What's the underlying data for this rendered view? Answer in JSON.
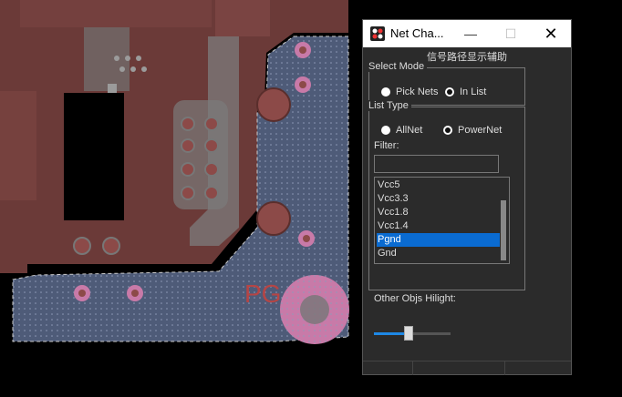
{
  "window": {
    "title": "Net Cha...",
    "subtitle": "信号路径显示辅助",
    "minimize_glyph": "—",
    "maximize_glyph": "☐",
    "close_glyph": "✕"
  },
  "select_mode": {
    "legend": "Select Mode",
    "options": [
      {
        "label": "Pick Nets",
        "checked": false
      },
      {
        "label": "In List",
        "checked": true
      }
    ]
  },
  "list_type": {
    "legend": "List Type",
    "options": [
      {
        "label": "AllNet",
        "checked": false
      },
      {
        "label": "PowerNet",
        "checked": true
      }
    ]
  },
  "filter": {
    "label": "Filter:",
    "value": "",
    "placeholder": ""
  },
  "net_list": {
    "items": [
      "Vcc5",
      "Vcc3.3",
      "Vcc1.8",
      "Vcc1.4",
      "Pgnd",
      "Gnd"
    ],
    "selected": "Pgnd"
  },
  "hilight": {
    "label": "Other Objs Hilight:",
    "value": 0.45
  },
  "pcb": {
    "silk_text": "PG",
    "colors": {
      "board": "#6b3a38",
      "pour": "#4e5b78",
      "copper": "#8c4a48",
      "pad": "#9b9b9b",
      "highlight": "#c87aa8"
    }
  }
}
